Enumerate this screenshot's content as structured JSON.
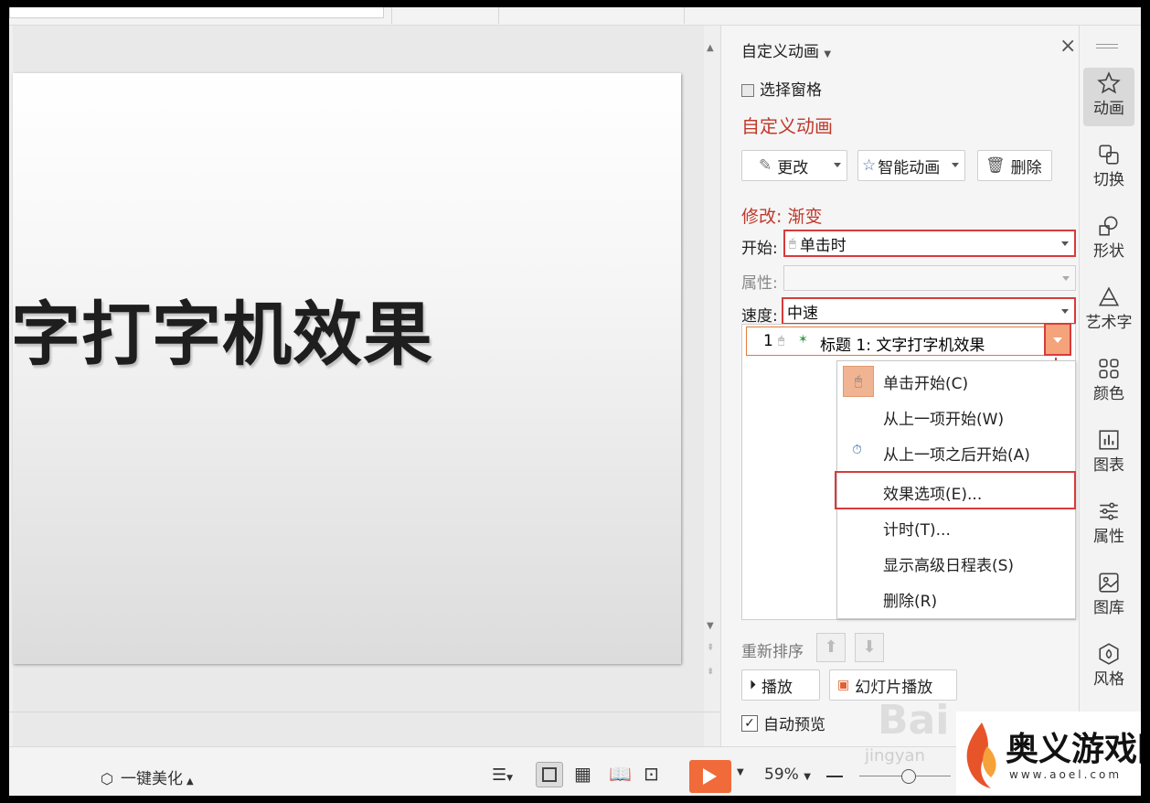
{
  "slide": {
    "title": "字打字机效果"
  },
  "panel": {
    "header_title": "自定义动画",
    "select_pane": "选择窗格",
    "section_title": "自定义动画",
    "change_label": "更改",
    "smart_anim_label": "智能动画",
    "delete_label": "删除",
    "modify_title": "修改: 渐变",
    "start_label": "开始:",
    "start_value": "单击时",
    "property_label": "属性:",
    "property_value": "",
    "speed_label": "速度:",
    "speed_value": "中速",
    "list_item": {
      "index": "1",
      "text": "标题 1: 文字打字机效果"
    },
    "menu": [
      "单击开始(C)",
      "从上一项开始(W)",
      "从上一项之后开始(A)",
      "效果选项(E)...",
      "计时(T)...",
      "显示高级日程表(S)",
      "删除(R)"
    ],
    "reorder_label": "重新排序",
    "play_label": "播放",
    "slideshow_label": "幻灯片播放",
    "auto_preview_label": "自动预览",
    "auto_preview_checked": true
  },
  "sidebar": [
    {
      "label": "动画",
      "icon": "star-icon",
      "active": true
    },
    {
      "label": "切换",
      "icon": "switch-icon"
    },
    {
      "label": "形状",
      "icon": "shapes-icon"
    },
    {
      "label": "艺术字",
      "icon": "wordart-icon"
    },
    {
      "label": "颜色",
      "icon": "color-grid-icon"
    },
    {
      "label": "图表",
      "icon": "chart-icon"
    },
    {
      "label": "属性",
      "icon": "sliders-icon"
    },
    {
      "label": "图库",
      "icon": "image-icon"
    },
    {
      "label": "风格",
      "icon": "style-icon"
    }
  ],
  "statusbar": {
    "beautify_label": "一键美化",
    "zoom": "59%"
  },
  "watermark": {
    "site_name": "奥义游戏网",
    "site_url": "www.aoel.com",
    "baidu_text": "Bai",
    "jingyan_text": "jingyan"
  },
  "colors": {
    "accent_red": "#c0392b",
    "highlight_box": "#d83b3b",
    "play_orange": "#f06a3a"
  }
}
